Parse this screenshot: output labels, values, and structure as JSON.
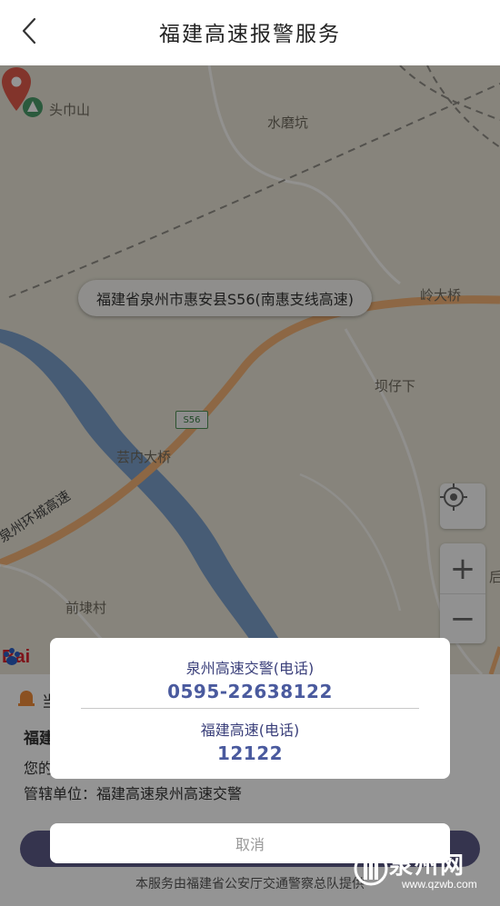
{
  "header": {
    "title": "福建高速报警服务",
    "back_icon": "chevron-left-icon"
  },
  "map": {
    "places": {
      "toujinshan": "头巾山",
      "shuimokeng": "水磨坑",
      "ling_bridge": "岭大桥",
      "baziaxia": "坝仔下",
      "yunnei_bridge": "芸内大桥",
      "huancheng": "泉州环城高速",
      "qianlucun": "前埭村",
      "edge_char": "后"
    },
    "address": "福建省泉州市惠安县S56(南惠支线高速)",
    "road_badge": "S56",
    "zoom_in": "+",
    "zoom_out": "−",
    "logo": "Baidu"
  },
  "info": {
    "status_prefix": "当",
    "name_prefix": "福建",
    "you_prefix": "您的",
    "jurisdiction": "管辖单位：福建高速泉州高速交警",
    "footer": "本服务由福建省公安厅交通警察总队提供"
  },
  "dialog": {
    "contacts": [
      {
        "label": "泉州高速交警(电话)",
        "number": "0595-22638122"
      },
      {
        "label": "福建高速(电话)",
        "number": "12122"
      }
    ],
    "cancel": "取消"
  },
  "watermark": {
    "name": "泉州网",
    "url": "www.qzwb.com"
  },
  "colors": {
    "road": "#f3b275",
    "river": "#6f97c9",
    "pin": "#e05a4b",
    "number": "#4a5a9e"
  }
}
